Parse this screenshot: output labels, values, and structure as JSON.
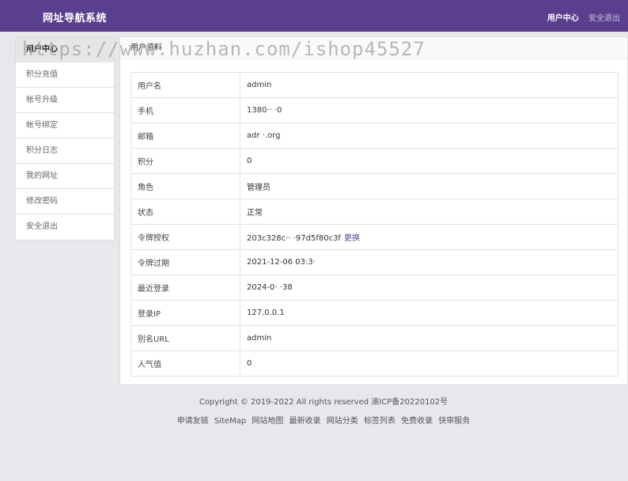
{
  "header": {
    "brand": "网址导航系统",
    "nav": [
      {
        "label": "用户中心",
        "active": true
      },
      {
        "label": "安全退出",
        "active": false
      }
    ],
    "bg_color": "#5b3f8f"
  },
  "sidebar": {
    "items": [
      {
        "label": "用户中心",
        "active": true
      },
      {
        "label": "积分充值",
        "active": false
      },
      {
        "label": "帐号升级",
        "active": false
      },
      {
        "label": "帐号绑定",
        "active": false
      },
      {
        "label": "积分日志",
        "active": false
      },
      {
        "label": "我的网址",
        "active": false
      },
      {
        "label": "修改密码",
        "active": false
      },
      {
        "label": "安全退出",
        "active": false
      }
    ]
  },
  "main": {
    "title": "用户资料",
    "rows": [
      {
        "key": "用户名",
        "value": "admin"
      },
      {
        "key": "手机",
        "value": "1380·· ·0"
      },
      {
        "key": "邮箱",
        "value": "adr  ·.org"
      },
      {
        "key": "积分",
        "value": "0"
      },
      {
        "key": "角色",
        "value": "管理员"
      },
      {
        "key": "状态",
        "value": "正常"
      },
      {
        "key": "令牌授权",
        "value": "203c328c·· ·97d5f80c3f",
        "link": "更换"
      },
      {
        "key": "令牌过期",
        "value": "2021-12-06 03:3·"
      },
      {
        "key": "最近登录",
        "value": "2024-0· ·38"
      },
      {
        "key": "登录IP",
        "value": "127.0.0.1"
      },
      {
        "key": "别名URL",
        "value": "admin"
      },
      {
        "key": "人气值",
        "value": "0"
      }
    ]
  },
  "footer": {
    "copyright": "Copyright © 2019-2022 All rights reserved 渝ICP备20220102号",
    "links": [
      "申请友链",
      "SiteMap",
      "网站地图",
      "最新收录",
      "网站分类",
      "标签列表",
      "免费收录",
      "快审服务"
    ]
  },
  "watermark": "https://www.huzhan.com/ishop45527"
}
